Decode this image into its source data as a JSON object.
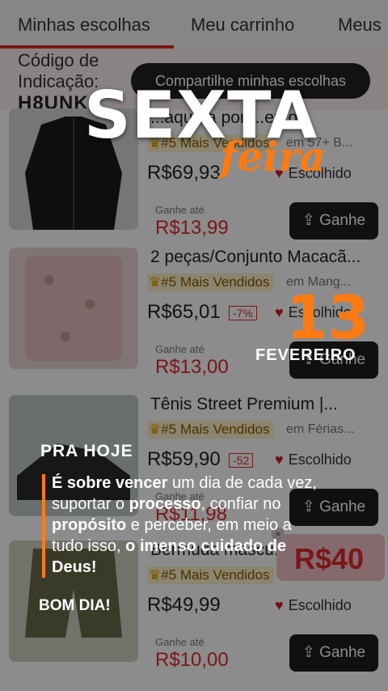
{
  "tabs": [
    {
      "label": "Minhas escolhas",
      "active": true
    },
    {
      "label": "Meu carrinho",
      "active": false
    },
    {
      "label": "Meus",
      "active": false
    }
  ],
  "referral": {
    "label": "Código de Indicação:",
    "code": "H8UNK",
    "share_label": "Compartilhe minhas escolhas"
  },
  "products": [
    {
      "title": "...aqueta por ...ento...",
      "badge": "#5 Mais Vendidos",
      "category": "em 57+ B...",
      "price": "R$69,93",
      "discount": "",
      "favorite": "Escolhido",
      "earn_label": "Ganhe até",
      "earn_value": "R$13,99",
      "earn_button": "Ganhe",
      "thumb_color": "#222222"
    },
    {
      "title": "2 peças/Conjunto Macacã...",
      "badge": "#5 Mais Vendidos",
      "category": "em Mang...",
      "price": "R$65,01",
      "discount": "-7%",
      "favorite": "Escolhido",
      "earn_label": "Ganhe até",
      "earn_value": "R$13,00",
      "earn_button": "Ganhe",
      "thumb_color": "#e8c8c8"
    },
    {
      "title": "Tênis Street Premium |...",
      "badge": "#5 Mais Vendidos",
      "category": "em Férias...",
      "price": "R$59,90",
      "discount": "-52",
      "favorite": "Escolhido",
      "earn_label": "Ganhe até",
      "earn_value": "R$11,98",
      "earn_button": "Ganhe",
      "thumb_color": "#2a2a2a"
    },
    {
      "title": "Bermuda mascu...",
      "badge": "#5 Mais Vendidos",
      "category": "",
      "price": "R$49,99",
      "discount": "",
      "favorite": "Escolhido",
      "earn_label": "Ganhe até",
      "earn_value": "R$10,00",
      "earn_button": "Ganhe",
      "thumb_color": "#6b6b4a"
    }
  ],
  "promo": {
    "label": "R$40",
    "close": "×"
  },
  "story": {
    "headline": "SEXTA",
    "headline_script": "feira",
    "day": "13",
    "month": "FEVEREIRO",
    "kicker": "PRA HOJE",
    "message_parts": [
      {
        "text": "É sobre vencer",
        "bold": true
      },
      {
        "text": " um dia de cada vez, suportar o ",
        "bold": false
      },
      {
        "text": "processo",
        "bold": true
      },
      {
        "text": ", confiar no ",
        "bold": false
      },
      {
        "text": "propósito",
        "bold": true
      },
      {
        "text": " e perceber, em meio a tudo isso, ",
        "bold": false
      },
      {
        "text": "o imenso cuidado de Deus!",
        "bold": true
      }
    ],
    "signoff": "BOM DIA!"
  },
  "colors": {
    "accent": "#e0282e",
    "orange": "#ff7a12",
    "dark_button": "#1e1e1e"
  }
}
